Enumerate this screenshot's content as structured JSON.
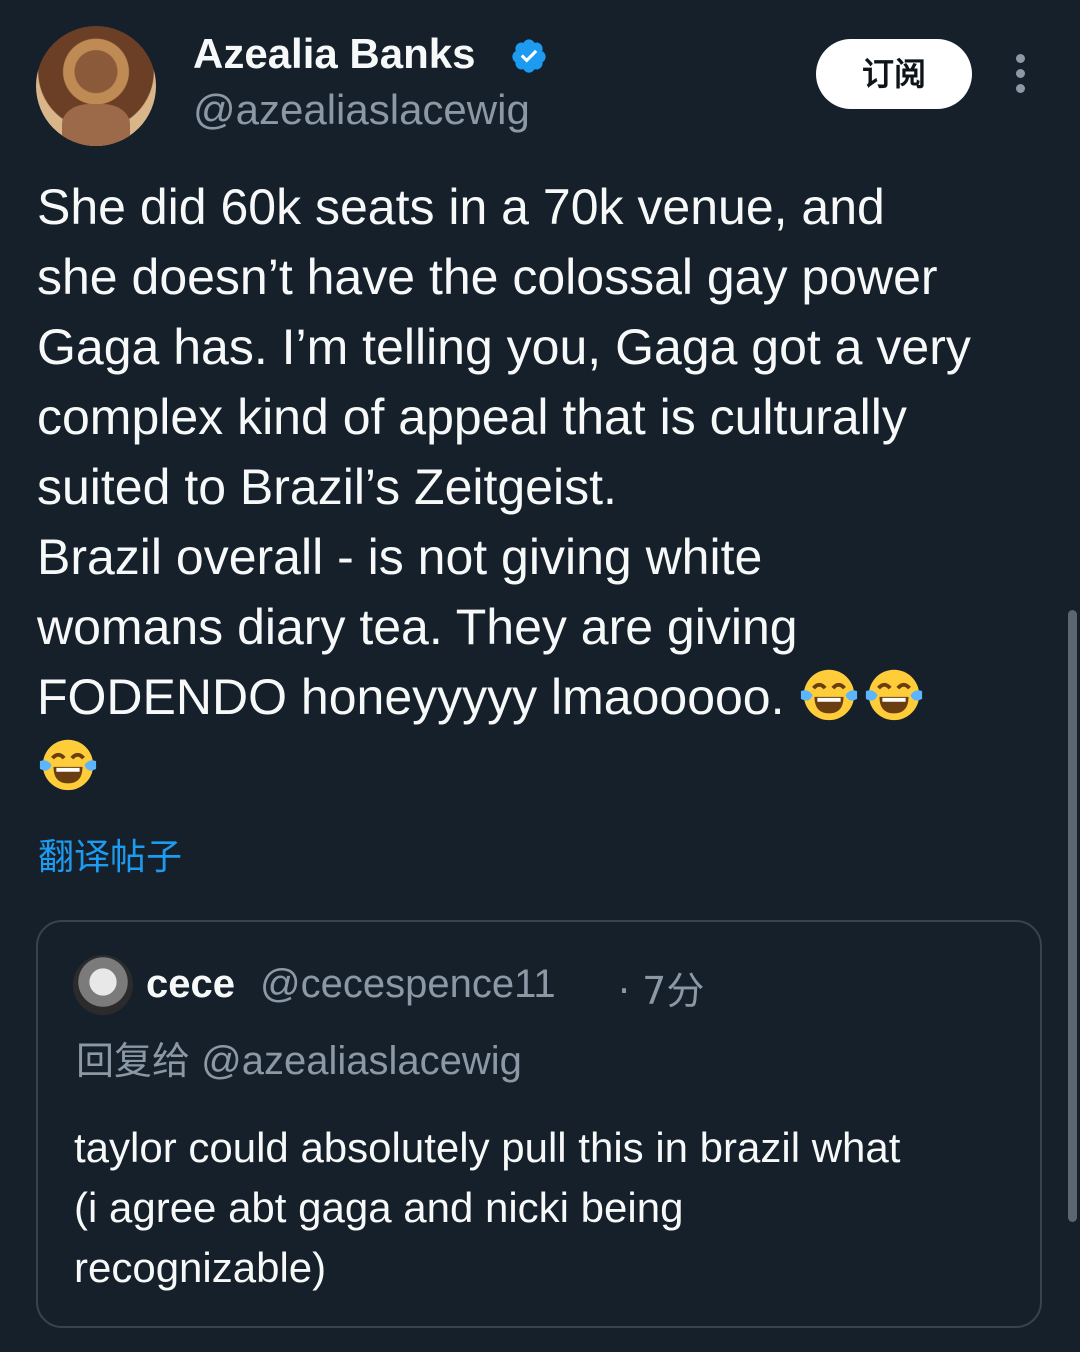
{
  "author": {
    "name": "Azealia Banks",
    "handle": "@azealiaslacewig",
    "verified_icon": "verified-badge-icon",
    "avatar_icon": "profile-photo"
  },
  "actions": {
    "subscribe_label": "订阅",
    "more_icon": "more-vertical-icon"
  },
  "tweet": {
    "lines": [
      "She did 60k seats in a 70k venue, and",
      "she doesn’t have the colossal gay power",
      "Gaga has. I’m telling you, Gaga got a very",
      "complex kind of appeal that is culturally",
      "suited to Brazil’s Zeitgeist.",
      "Brazil overall - is not giving white",
      "womans diary tea. They are giving",
      "FODENDO honeyyyyy lmaooooo."
    ],
    "emoji_name": "face-with-tears-of-joy",
    "emoji_count": 3,
    "translate_label": "翻译帖子"
  },
  "quoted": {
    "name": "cece",
    "handle": "@cecespence11",
    "time": "· 7分",
    "reply_prefix": "回复给",
    "reply_to": "@azealiaslacewig",
    "lines": [
      "taylor could absolutely pull this in brazil what",
      "(i agree abt gaga and nicki being",
      "recognizable)"
    ]
  },
  "colors": {
    "background": "#15202b",
    "text": "#f7f9f9",
    "secondary": "#8b98a5",
    "accent": "#1d9bf0",
    "border": "#38444d"
  }
}
